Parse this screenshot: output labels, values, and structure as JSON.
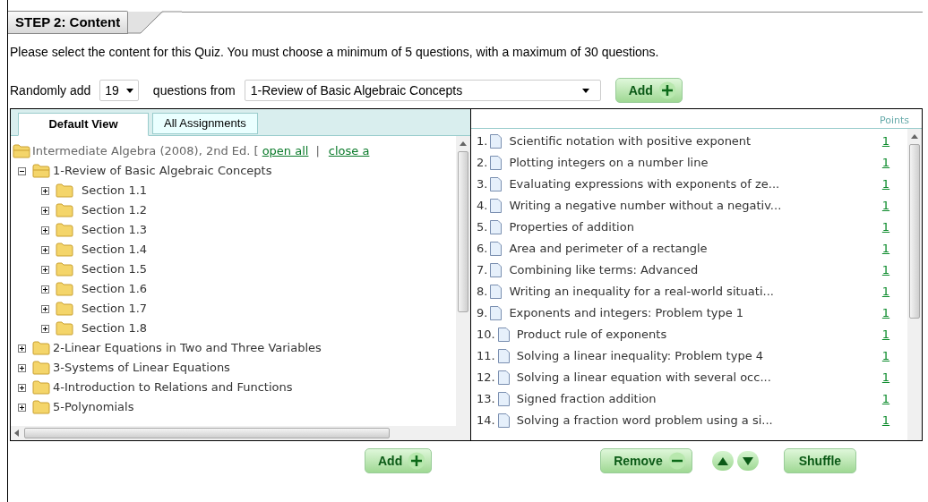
{
  "step_header": {
    "title": "STEP 2: Content"
  },
  "instructions": "Please select the content for this Quiz. You must choose a minimum of 5 questions, with a maximum of 30 questions.",
  "random_add": {
    "label_before": "Randomly add",
    "count": "19",
    "label_middle": "questions from",
    "source": "1-Review of Basic Algebraic Concepts",
    "button": "Add"
  },
  "left_panel": {
    "tabs": [
      {
        "label": "Default View",
        "selected": true
      },
      {
        "label": "All Assignments",
        "selected": false
      }
    ],
    "tree": {
      "label": "Intermediate Algebra (2008), 2nd Ed. [",
      "links": [
        "open all",
        "close a"
      ],
      "separator": "|",
      "children": [
        {
          "label": "1-Review of Basic Algebraic Concepts",
          "expanded": true,
          "children": [
            {
              "label": "Section 1.1",
              "expanded": false
            },
            {
              "label": "Section 1.2",
              "expanded": false
            },
            {
              "label": "Section 1.3",
              "expanded": false
            },
            {
              "label": "Section 1.4",
              "expanded": false
            },
            {
              "label": "Section 1.5",
              "expanded": false
            },
            {
              "label": "Section 1.6",
              "expanded": false
            },
            {
              "label": "Section 1.7",
              "expanded": false
            },
            {
              "label": "Section 1.8",
              "expanded": false
            }
          ]
        },
        {
          "label": "2-Linear Equations in Two and Three Variables",
          "expanded": false
        },
        {
          "label": "3-Systems of Linear Equations",
          "expanded": false
        },
        {
          "label": "4-Introduction to Relations and Functions",
          "expanded": false
        },
        {
          "label": "5-Polynomials",
          "expanded": false
        }
      ]
    },
    "button": "Add"
  },
  "right_panel": {
    "points_header": "Points",
    "questions": [
      {
        "number": "1.",
        "title": "Scientific notation with positive exponent",
        "points": "1"
      },
      {
        "number": "2.",
        "title": "Plotting integers on a number line",
        "points": "1"
      },
      {
        "number": "3.",
        "title": "Evaluating expressions with exponents of ze...",
        "points": "1"
      },
      {
        "number": "4.",
        "title": "Writing a negative number without a negativ...",
        "points": "1"
      },
      {
        "number": "5.",
        "title": "Properties of addition",
        "points": "1"
      },
      {
        "number": "6.",
        "title": "Area and perimeter of a rectangle",
        "points": "1"
      },
      {
        "number": "7.",
        "title": "Combining like terms: Advanced",
        "points": "1"
      },
      {
        "number": "8.",
        "title": "Writing an inequality for a real-world situati...",
        "points": "1"
      },
      {
        "number": "9.",
        "title": "Exponents and integers: Problem type 1",
        "points": "1"
      },
      {
        "number": "10.",
        "title": "Product rule of exponents",
        "points": "1"
      },
      {
        "number": "11.",
        "title": "Solving a linear inequality: Problem type 4",
        "points": "1"
      },
      {
        "number": "12.",
        "title": "Solving a linear equation with several occ...",
        "points": "1"
      },
      {
        "number": "13.",
        "title": "Signed fraction addition",
        "points": "1"
      },
      {
        "number": "14.",
        "title": "Solving a fraction word problem using a si...",
        "points": "1"
      }
    ],
    "remove_button": "Remove",
    "shuffle_button": "Shuffle"
  }
}
